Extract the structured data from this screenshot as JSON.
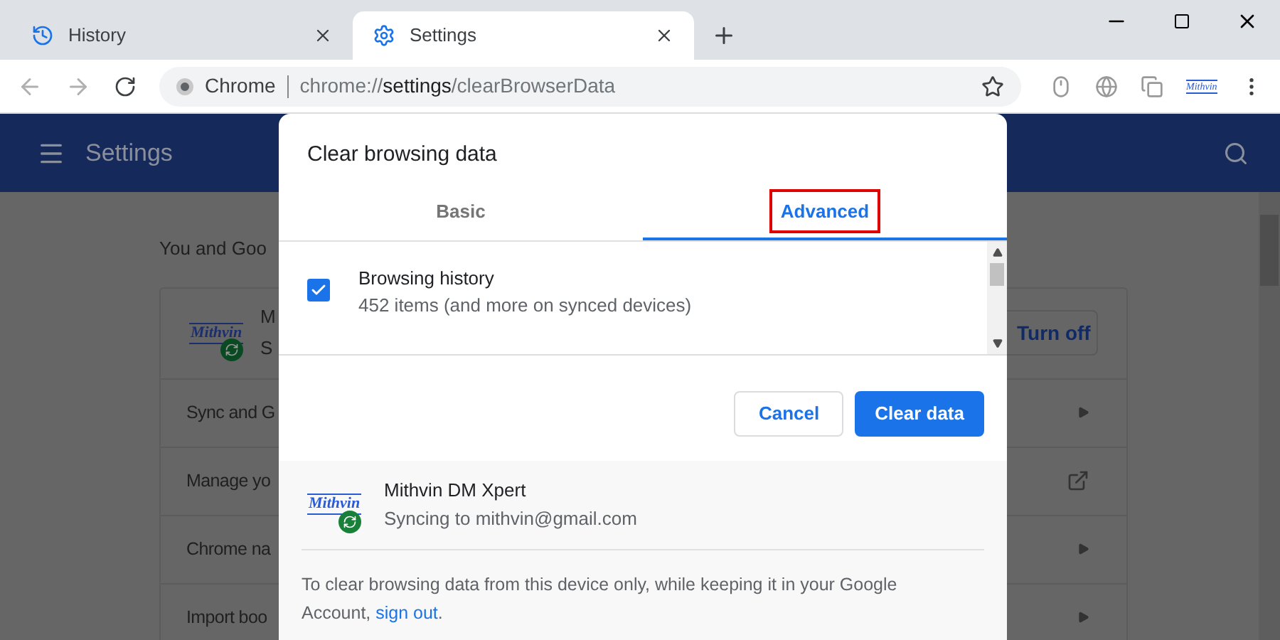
{
  "browser": {
    "tabs": [
      {
        "label": "History",
        "selected": false
      },
      {
        "label": "Settings",
        "selected": true
      }
    ],
    "address": {
      "site_label": "Chrome",
      "url_scheme": "chrome://",
      "url_host": "settings",
      "url_path": "/clearBrowserData"
    },
    "extension_logo": "Mithvin"
  },
  "settings_page": {
    "title": "Settings",
    "section_heading": "You and Goo",
    "profile": {
      "logo": "Mithvin",
      "name": "M",
      "status": "S",
      "button": "Turn off"
    },
    "rows": [
      {
        "label": "Sync and G",
        "kind": "submenu"
      },
      {
        "label": "Manage yo",
        "kind": "external"
      },
      {
        "label": "Chrome na",
        "kind": "submenu"
      },
      {
        "label": "Import boo",
        "kind": "submenu"
      }
    ]
  },
  "dialog": {
    "title": "Clear browsing data",
    "tabs": [
      {
        "label": "Basic",
        "selected": false,
        "highlighted": false
      },
      {
        "label": "Advanced",
        "selected": true,
        "highlighted": true
      }
    ],
    "items": [
      {
        "label": "Browsing history",
        "detail": "452 items (and more on synced devices)",
        "checked": true
      }
    ],
    "buttons": [
      {
        "label": "Cancel",
        "kind": "secondary"
      },
      {
        "label": "Clear data",
        "kind": "primary"
      }
    ],
    "account": {
      "logo": "Mithvin",
      "name": "Mithvin DM Xpert",
      "status": "Syncing to mithvin@gmail.com"
    },
    "footer": {
      "text": "To clear browsing data from this device only, while keeping it in your Google Account,",
      "link": "sign out",
      "end": "."
    }
  }
}
